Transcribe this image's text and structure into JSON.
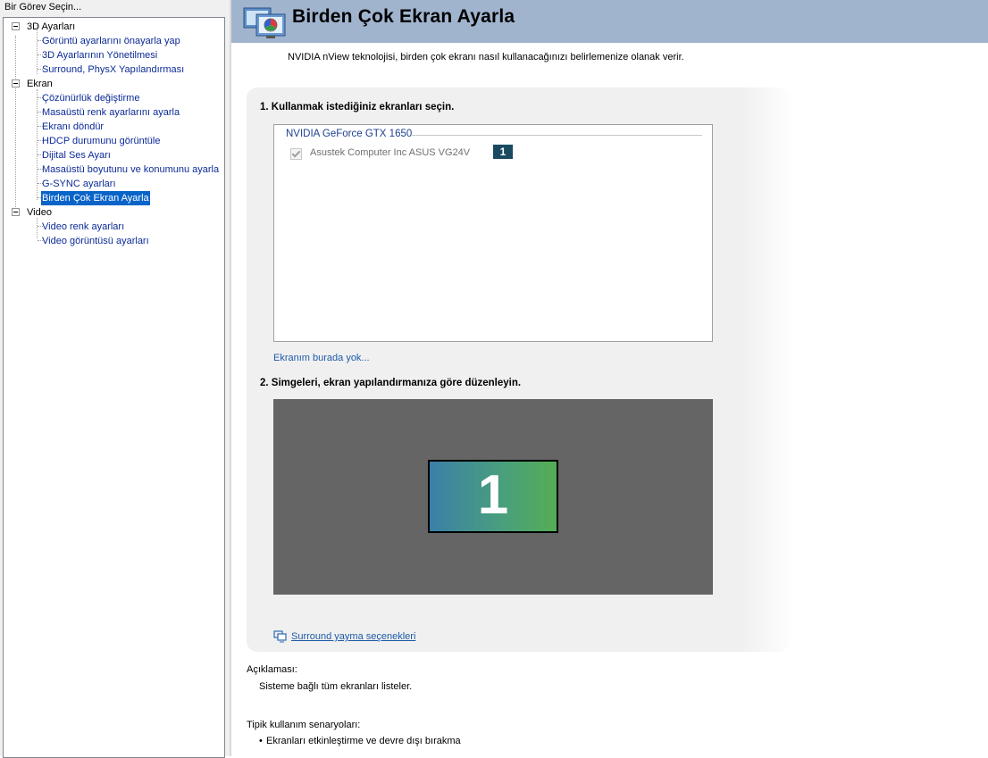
{
  "left_pane": {
    "title": "Bir Görev Seçin...",
    "categories": [
      {
        "label": "3D Ayarları",
        "items": [
          {
            "label": "Görüntü ayarlarını önayarla yap"
          },
          {
            "label": "3D Ayarlarının Yönetilmesi"
          },
          {
            "label": "Surround, PhysX Yapılandırması"
          }
        ]
      },
      {
        "label": "Ekran",
        "items": [
          {
            "label": "Çözünürlük değiştirme"
          },
          {
            "label": "Masaüstü renk ayarlarını ayarla"
          },
          {
            "label": "Ekranı döndür"
          },
          {
            "label": "HDCP durumunu görüntüle"
          },
          {
            "label": "Dijital Ses Ayarı"
          },
          {
            "label": "Masaüstü boyutunu ve konumunu ayarla"
          },
          {
            "label": "G-SYNC ayarları"
          },
          {
            "label": "Birden Çok Ekran Ayarla",
            "selected": true
          }
        ]
      },
      {
        "label": "Video",
        "items": [
          {
            "label": "Video renk ayarları"
          },
          {
            "label": "Video görüntüsü ayarları"
          }
        ]
      }
    ]
  },
  "header": {
    "title": "Birden Çok Ekran Ayarla",
    "icon": "multi-display-icon",
    "background_color": "#a0b4ce"
  },
  "subtitle": "NVIDIA nView teknolojisi, birden çok ekranı nasıl kullanacağınızı belirlemenize olanak verir.",
  "step1": {
    "label": "1. Kullanmak istediğiniz ekranları seçin.",
    "gpu_name": "NVIDIA GeForce GTX 1650",
    "displays": [
      {
        "name": "Asustek Computer Inc ASUS VG24V",
        "checked": true,
        "badge": "1"
      }
    ],
    "missing_link": "Ekranım burada yok..."
  },
  "step2": {
    "label": "2. Simgeleri, ekran yapılandırmanıza göre düzenleyin.",
    "monitor_number": "1"
  },
  "surround_link": {
    "text": "Surround yayma seçenekleri",
    "icon": "surround-icon"
  },
  "description": {
    "heading": "Açıklaması:",
    "body": "Sisteme bağlı tüm ekranları listeler."
  },
  "usage": {
    "heading": "Tipik kullanım senaryoları:",
    "bullet": "•",
    "items": [
      "Ekranları etkinleştirme ve devre dışı bırakma"
    ]
  },
  "colors": {
    "accent_selected": "#0a64c8",
    "link": "#1d5aa8",
    "badge": "#1a4a62"
  }
}
